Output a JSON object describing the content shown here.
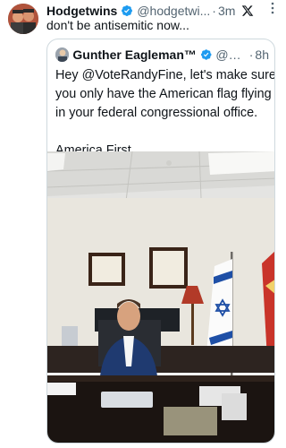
{
  "tweet": {
    "author_name": "Hodgetwins",
    "author_handle": "@hodgetwi...",
    "separator": "·",
    "time": "3m",
    "text": "don't be antisemitic now..."
  },
  "quote": {
    "author_name": "Gunther Eagleman™",
    "author_handle": "@G...",
    "separator": "·",
    "time": "8h",
    "lines": [
      "Hey @VoteRandyFine, let's make sure",
      "you only have the American flag flying",
      "in your federal congressional office."
    ],
    "closing": "America First."
  },
  "colors": {
    "verified_blue": "#1d9bf0",
    "secondary_text": "#536471",
    "border": "#cfd9de"
  },
  "icons": {
    "verified": "verified-badge-icon",
    "platform": "x-logo-icon",
    "more": "more-options-icon"
  }
}
